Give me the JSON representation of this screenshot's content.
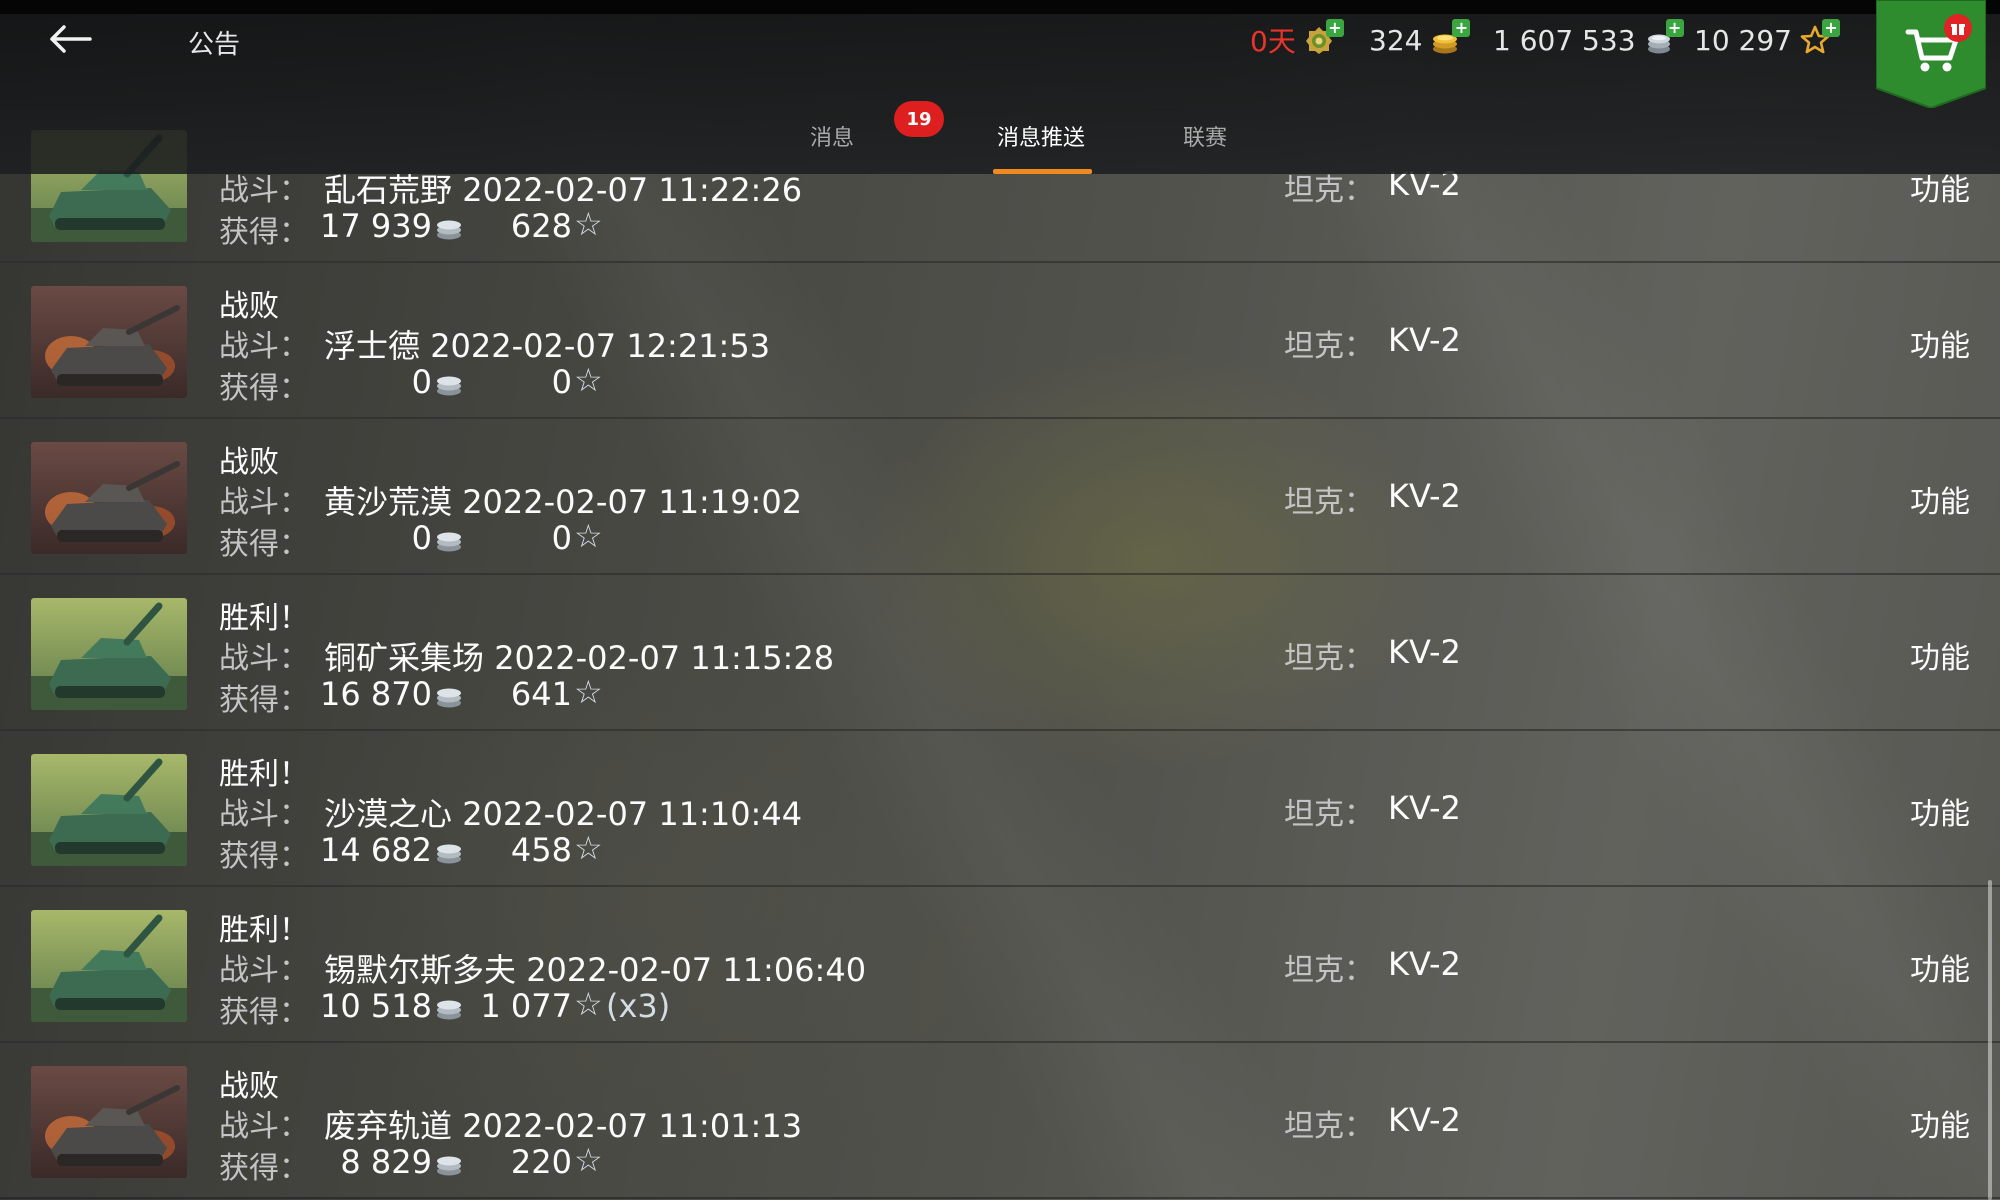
{
  "header": {
    "title": "公告",
    "currencies": {
      "premium_days": "0天",
      "gold": "324",
      "credits": "1 607 533",
      "free_xp": "10 297"
    },
    "shop_badge_icon": "gift-icon"
  },
  "tabs": [
    {
      "label": "消息",
      "badge": "19",
      "active": false
    },
    {
      "label": "消息推送",
      "active": true
    },
    {
      "label": "联赛",
      "active": false
    }
  ],
  "labels": {
    "battle": "战斗：",
    "earned": "获得：",
    "tank": "坦克：",
    "action": "功能"
  },
  "battles": [
    {
      "result": "",
      "thumb": "victory",
      "map": "乱石荒野",
      "datetime": "2022-02-07 11:22:26",
      "credits": "17 939",
      "xp": "628",
      "mult": "",
      "tank": "KV-2"
    },
    {
      "result": "战败",
      "thumb": "defeat",
      "map": "浮士德",
      "datetime": "2022-02-07 12:21:53",
      "credits": "0",
      "xp": "0",
      "mult": "",
      "tank": "KV-2"
    },
    {
      "result": "战败",
      "thumb": "defeat",
      "map": "黄沙荒漠",
      "datetime": "2022-02-07 11:19:02",
      "credits": "0",
      "xp": "0",
      "mult": "",
      "tank": "KV-2"
    },
    {
      "result": "胜利！",
      "thumb": "victory",
      "map": "铜矿采集场",
      "datetime": "2022-02-07 11:15:28",
      "credits": "16 870",
      "xp": "641",
      "mult": "",
      "tank": "KV-2"
    },
    {
      "result": "胜利！",
      "thumb": "victory",
      "map": "沙漠之心",
      "datetime": "2022-02-07 11:10:44",
      "credits": "14 682",
      "xp": "458",
      "mult": "",
      "tank": "KV-2"
    },
    {
      "result": "胜利！",
      "thumb": "victory",
      "map": "锡默尔斯多夫",
      "datetime": "2022-02-07 11:06:40",
      "credits": "10 518",
      "xp": "1 077",
      "mult": "(x3)",
      "tank": "KV-2"
    },
    {
      "result": "战败",
      "thumb": "defeat",
      "map": "废弃轨道",
      "datetime": "2022-02-07 11:01:13",
      "credits": "8 829",
      "xp": "220",
      "mult": "",
      "tank": "KV-2"
    }
  ],
  "colors": {
    "accent": "#f08a1c",
    "badge": "#dd1f1f",
    "premium": "#e8342a",
    "plus": "#3aa63f",
    "shop": "#2e8b2e"
  }
}
